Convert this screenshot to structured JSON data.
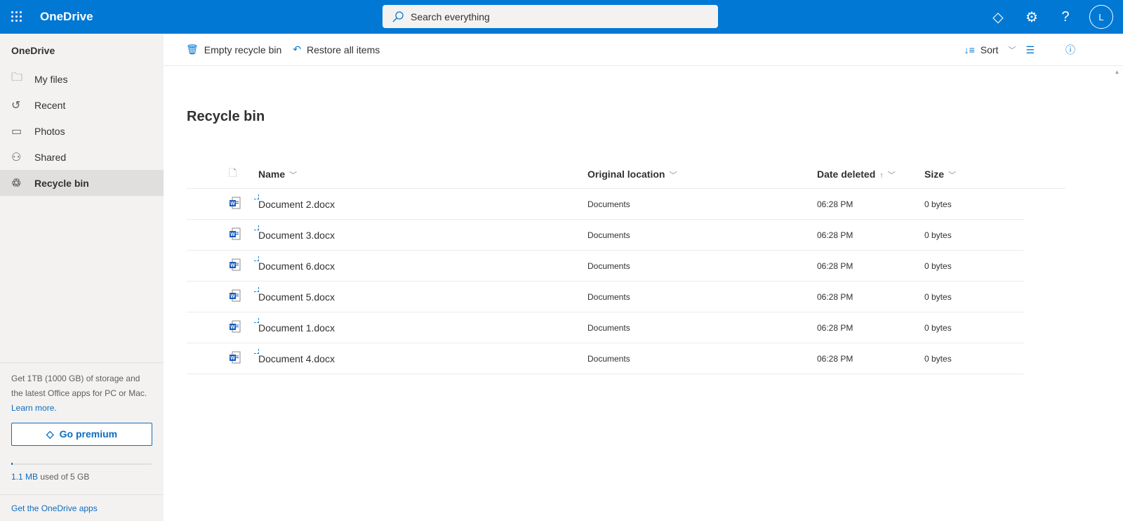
{
  "header": {
    "app_name": "OneDrive",
    "search_placeholder": "Search everything",
    "avatar_initial": "L"
  },
  "sidebar": {
    "title": "OneDrive",
    "items": [
      {
        "label": "My files",
        "icon": "folder-icon"
      },
      {
        "label": "Recent",
        "icon": "history-icon"
      },
      {
        "label": "Photos",
        "icon": "photo-icon"
      },
      {
        "label": "Shared",
        "icon": "people-icon"
      },
      {
        "label": "Recycle bin",
        "icon": "recycle-bin-icon"
      }
    ],
    "promo_line1": "Get 1TB (1000 GB) of storage and",
    "promo_line2": "the latest Office apps for PC or Mac.",
    "learn_more": "Learn more.",
    "go_premium": "Go premium",
    "storage_used": "1.1 MB",
    "storage_rest": " used of 5 GB",
    "storage_fraction": 0.0002,
    "get_apps": "Get the OneDrive apps"
  },
  "toolbar": {
    "empty": "Empty recycle bin",
    "restore": "Restore all items",
    "sort": "Sort"
  },
  "page_title": "Recycle bin",
  "columns": {
    "name": "Name",
    "location": "Original location",
    "date": "Date deleted",
    "date_sort": "↑",
    "size": "Size"
  },
  "files": [
    {
      "name": "Document 2.docx",
      "location": "Documents",
      "date": "06:28 PM",
      "size": "0 bytes"
    },
    {
      "name": "Document 3.docx",
      "location": "Documents",
      "date": "06:28 PM",
      "size": "0 bytes"
    },
    {
      "name": "Document 6.docx",
      "location": "Documents",
      "date": "06:28 PM",
      "size": "0 bytes"
    },
    {
      "name": "Document 5.docx",
      "location": "Documents",
      "date": "06:28 PM",
      "size": "0 bytes"
    },
    {
      "name": "Document 1.docx",
      "location": "Documents",
      "date": "06:28 PM",
      "size": "0 bytes"
    },
    {
      "name": "Document 4.docx",
      "location": "Documents",
      "date": "06:28 PM",
      "size": "0 bytes"
    }
  ]
}
